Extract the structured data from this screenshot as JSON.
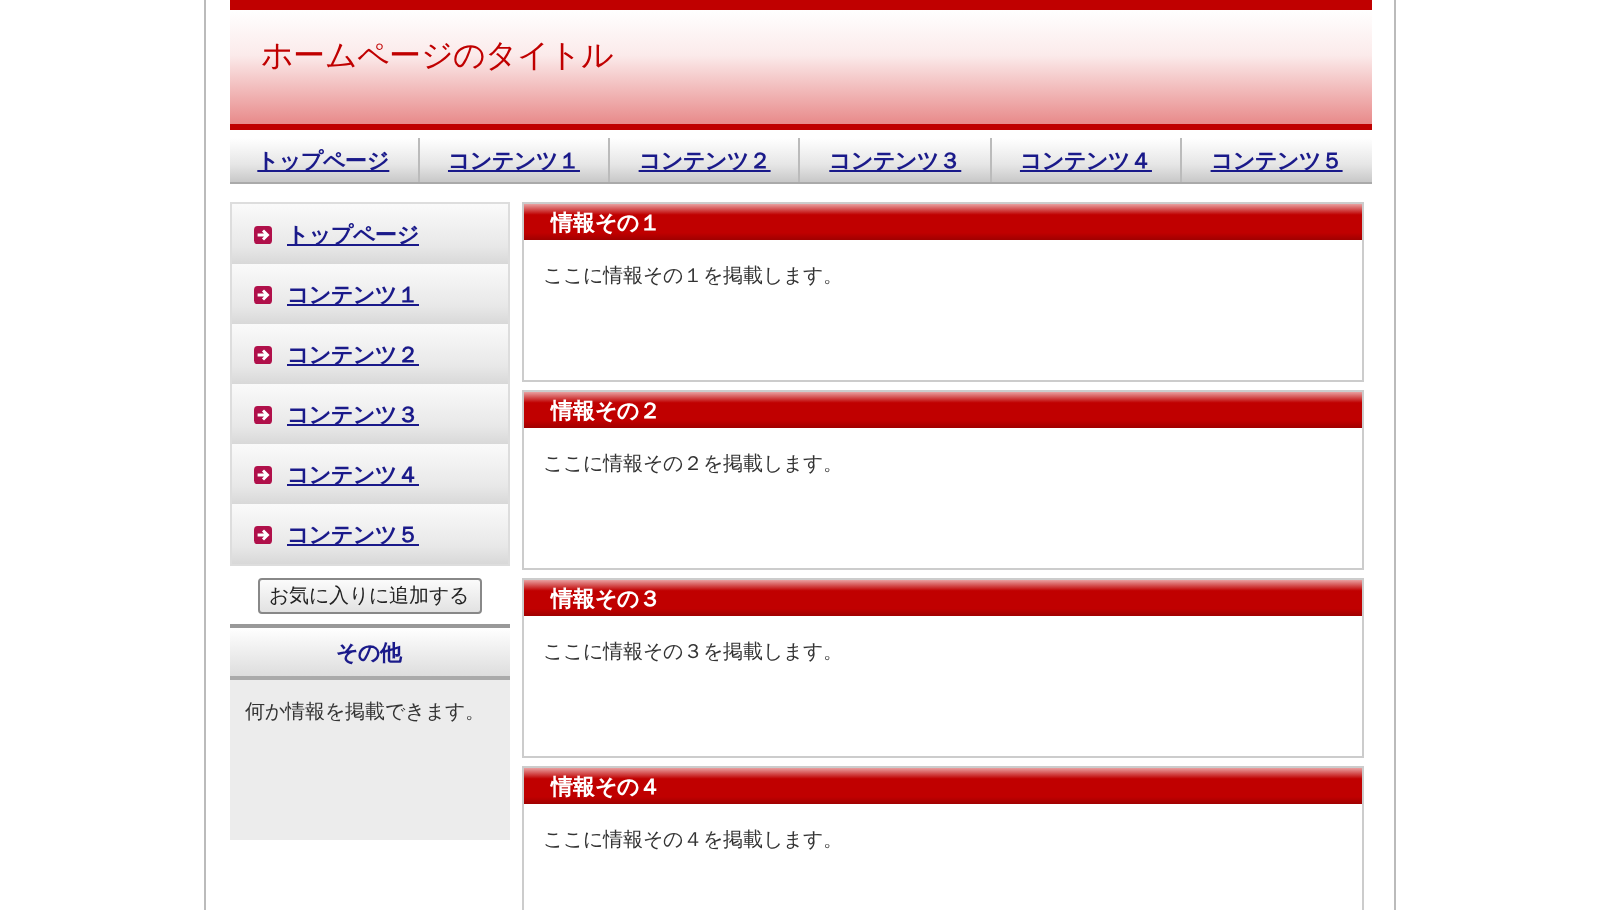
{
  "header": {
    "title": "ホームページのタイトル"
  },
  "nav": [
    "トップページ",
    "コンテンツ１",
    "コンテンツ２",
    "コンテンツ３",
    "コンテンツ４",
    "コンテンツ５"
  ],
  "sidebar": {
    "items": [
      "トップページ",
      "コンテンツ１",
      "コンテンツ２",
      "コンテンツ３",
      "コンテンツ４",
      "コンテンツ５"
    ],
    "bookmark_button": "お気に入りに追加する",
    "other": {
      "title": "その他",
      "text": "何か情報を掲載できます。"
    }
  },
  "sections": [
    {
      "title": "情報その１",
      "text": "ここに情報その１を掲載します。"
    },
    {
      "title": "情報その２",
      "text": "ここに情報その２を掲載します。"
    },
    {
      "title": "情報その３",
      "text": "ここに情報その３を掲載します。"
    },
    {
      "title": "情報その４",
      "text": "ここに情報その４を掲載します。"
    }
  ]
}
